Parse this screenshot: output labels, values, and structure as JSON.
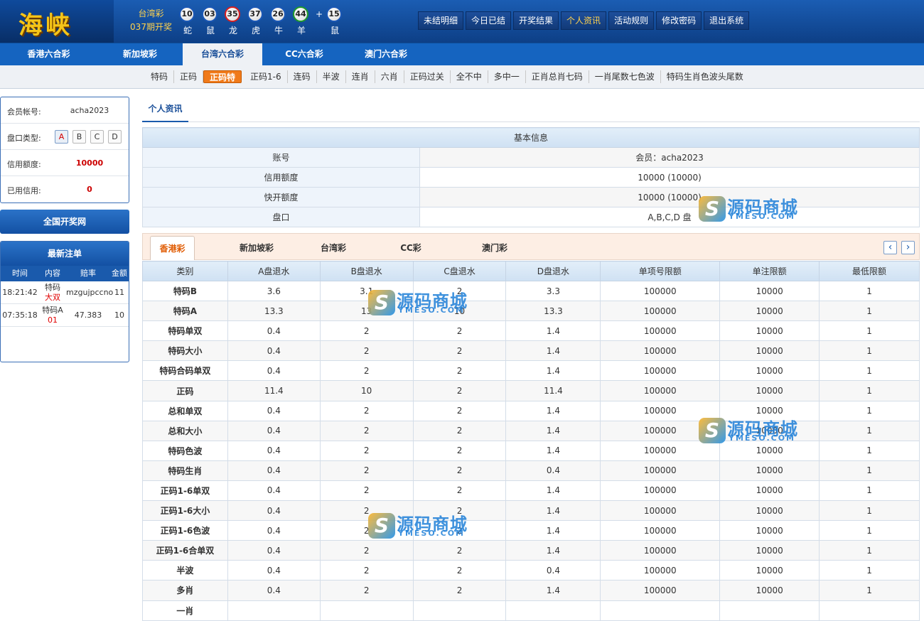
{
  "header": {
    "logo": "海峡",
    "lottery_name": "台湾彩",
    "issue": "037期开奖",
    "balls": [
      {
        "num": "10",
        "zodiac": "蛇",
        "color": "blue"
      },
      {
        "num": "03",
        "zodiac": "鼠",
        "color": "blue"
      },
      {
        "num": "35",
        "zodiac": "龙",
        "color": "red"
      },
      {
        "num": "37",
        "zodiac": "虎",
        "color": "blue"
      },
      {
        "num": "26",
        "zodiac": "牛",
        "color": "blue"
      },
      {
        "num": "44",
        "zodiac": "羊",
        "color": "green"
      }
    ],
    "plus": "+",
    "special_ball": {
      "num": "15",
      "zodiac": "鼠",
      "color": "blue"
    },
    "nav": [
      "未结明细",
      "今日已结",
      "开奖结果",
      "个人资讯",
      "活动规则",
      "修改密码",
      "退出系统"
    ],
    "nav_active": "个人资讯"
  },
  "lottery_tabs": [
    "香港六合彩",
    "新加坡彩",
    "台湾六合彩",
    "CC六合彩",
    "澳门六合彩"
  ],
  "lottery_tab_active": "台湾六合彩",
  "sub_nav": [
    "特码",
    "正码",
    "正码特",
    "正码1-6",
    "连码",
    "半波",
    "连肖",
    "六肖",
    "正码过关",
    "全不中",
    "多中一",
    "正肖总肖七码",
    "一肖尾数七色波",
    "特码生肖色波头尾数"
  ],
  "sub_nav_active": "正码特",
  "member": {
    "account_label": "会员帐号:",
    "account": "acha2023",
    "pan_label": "盘口类型:",
    "pans": [
      "A",
      "B",
      "C",
      "D"
    ],
    "pan_active": "A",
    "credit_label": "信用额度:",
    "credit": "10000",
    "used_label": "已用信用:",
    "used": "0"
  },
  "draw_button": "全国开奖网",
  "recent": {
    "title": "最新注单",
    "headers": [
      "时间",
      "内容",
      "赔率",
      "金额"
    ],
    "rows": [
      {
        "time": "18:21:42",
        "content1": "特码",
        "content2": "大双",
        "odds": "mzgujpccno",
        "amount": "11"
      },
      {
        "time": "07:35:18",
        "content1": "特码A",
        "content2": "01",
        "odds": "47.383",
        "amount": "10"
      }
    ]
  },
  "main_tab": "个人资讯",
  "basic": {
    "title": "基本信息",
    "rows": [
      {
        "label": "账号",
        "value": "会员：acha2023"
      },
      {
        "label": "信用额度",
        "value": "10000 (10000)"
      },
      {
        "label": "快开额度",
        "value": "10000 (10000)"
      },
      {
        "label": "盘口",
        "value": "A,B,C,D 盘"
      }
    ]
  },
  "game_tabs": [
    "香港彩",
    "新加坡彩",
    "台湾彩",
    "CC彩",
    "澳门彩"
  ],
  "game_tab_active": "香港彩",
  "arrows": {
    "prev": "‹",
    "next": "›"
  },
  "limits": {
    "headers": [
      "类别",
      "A盘退水",
      "B盘退水",
      "C盘退水",
      "D盘退水",
      "单项号限额",
      "单注限额",
      "最低限额"
    ],
    "rows": [
      [
        "特码B",
        "3.6",
        "3.1",
        "2",
        "3.3",
        "100000",
        "10000",
        "1"
      ],
      [
        "特码A",
        "13.3",
        "13",
        "10",
        "13.3",
        "100000",
        "10000",
        "1"
      ],
      [
        "特码单双",
        "0.4",
        "2",
        "2",
        "1.4",
        "100000",
        "10000",
        "1"
      ],
      [
        "特码大小",
        "0.4",
        "2",
        "2",
        "1.4",
        "100000",
        "10000",
        "1"
      ],
      [
        "特码合码单双",
        "0.4",
        "2",
        "2",
        "1.4",
        "100000",
        "10000",
        "1"
      ],
      [
        "正码",
        "11.4",
        "10",
        "2",
        "11.4",
        "100000",
        "10000",
        "1"
      ],
      [
        "总和单双",
        "0.4",
        "2",
        "2",
        "1.4",
        "100000",
        "10000",
        "1"
      ],
      [
        "总和大小",
        "0.4",
        "2",
        "2",
        "1.4",
        "100000",
        "10000",
        "1"
      ],
      [
        "特码色波",
        "0.4",
        "2",
        "2",
        "1.4",
        "100000",
        "10000",
        "1"
      ],
      [
        "特码生肖",
        "0.4",
        "2",
        "2",
        "0.4",
        "100000",
        "10000",
        "1"
      ],
      [
        "正码1-6单双",
        "0.4",
        "2",
        "2",
        "1.4",
        "100000",
        "10000",
        "1"
      ],
      [
        "正码1-6大小",
        "0.4",
        "2",
        "2",
        "1.4",
        "100000",
        "10000",
        "1"
      ],
      [
        "正码1-6色波",
        "0.4",
        "2",
        "2",
        "1.4",
        "100000",
        "10000",
        "1"
      ],
      [
        "正码1-6合单双",
        "0.4",
        "2",
        "2",
        "1.4",
        "100000",
        "10000",
        "1"
      ],
      [
        "半波",
        "0.4",
        "2",
        "2",
        "0.4",
        "100000",
        "10000",
        "1"
      ],
      [
        "多肖",
        "0.4",
        "2",
        "2",
        "1.4",
        "100000",
        "10000",
        "1"
      ],
      [
        "一肖",
        "",
        "",
        "",
        "",
        "",
        "",
        ""
      ]
    ]
  },
  "watermark": {
    "letter": "S",
    "cn": "源码商城",
    "en": "YMESO.COM"
  }
}
